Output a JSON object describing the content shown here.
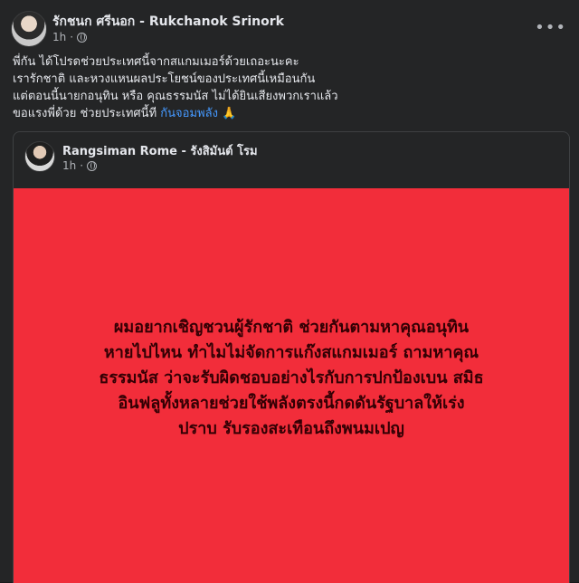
{
  "post": {
    "author": "รักชนก ศรีนอก - Rukchanok Srinork",
    "time": "1h",
    "caption_lines": [
      "พี่กัน ได้โปรดช่วยประเทศนี้จากสแกมเมอร์ด้วยเถอะนะคะ",
      "เรารักชาติ และหวงแหนผลประโยชน์ของประเทศนี้เหมือนกัน",
      "แต่ตอนนี้นายกอนุทิน หรือ คุณธรรมนัส ไม่ได้ยินเสียงพวกเราแล้ว",
      "ขอแรงพี่ด้วย ช่วยประเทศนี้ที"
    ],
    "hashtag": "กันจอมพลัง",
    "emoji": "🙏"
  },
  "shared_post": {
    "author": "Rangsiman Rome - รังสิมันต์ โรม",
    "time": "1h",
    "red_text_lines": [
      "ผมอยากเชิญชวนผู้รักชาติ ช่วยกันตามหาคุณอนุทิน",
      "หายไปไหน ทำไมไม่จัดการแก๊งสแกมเมอร์ ถามหาคุณ",
      "ธรรมนัส ว่าจะรับผิดชอบอย่างไรกับการปกป้องเบน สมิธ",
      "อินฟลูทั้งหลายช่วยใช้พลังตรงนี้กดดันรัฐบาลให้เร่ง",
      "ปราบ รับรองสะเทือนถึงพนมเปญ"
    ]
  },
  "icons": {
    "globe": "globe-icon",
    "more": "more-options-icon"
  },
  "colors": {
    "background": "#242526",
    "red_box": "#f22d3a",
    "red_text": "#330004",
    "hashtag": "#4599ff"
  }
}
